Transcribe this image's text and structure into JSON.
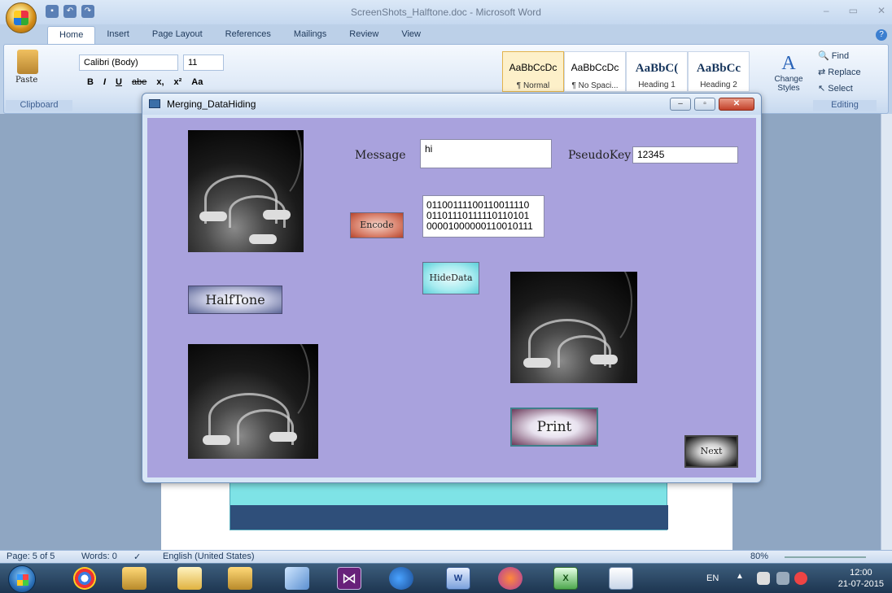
{
  "word": {
    "title": "ScreenShots_Halftone.doc - Microsoft Word",
    "tabs": [
      "Home",
      "Insert",
      "Page Layout",
      "References",
      "Mailings",
      "Review",
      "View"
    ],
    "font_name": "Calibri (Body)",
    "font_size": "11",
    "format_buttons": [
      "B",
      "I",
      "U",
      "abe",
      "x,",
      "x²",
      "Aa"
    ],
    "paste_label": "Paste",
    "group_labels": {
      "clipboard": "Clipboard",
      "editing": "Editing"
    },
    "styles": [
      {
        "preview": "AaBbCcDc",
        "name": "¶ Normal"
      },
      {
        "preview": "AaBbCcDc",
        "name": "¶ No Spaci..."
      },
      {
        "preview": "AaBbC(",
        "name": "Heading 1"
      },
      {
        "preview": "AaBbCc",
        "name": "Heading 2"
      }
    ],
    "change_styles": "Change Styles",
    "editing": {
      "find": "Find",
      "replace": "Replace",
      "select": "Select"
    },
    "status": {
      "page": "Page: 5 of 5",
      "words": "Words: 0",
      "language": "English (United States)",
      "zoom": "80%"
    }
  },
  "app": {
    "title": "Merging_DataHiding",
    "message_label": "Message",
    "message_value": "hi",
    "pseudokey_label": "PseudoKey",
    "pseudokey_value": "12345",
    "binary_lines": [
      "01100111100110011110",
      "01101110111110110101",
      "00001000000110010111"
    ],
    "buttons": {
      "encode": "Encode",
      "halftone": "HalfTone",
      "hidedata": "HideData",
      "print": "Print",
      "next": "Next"
    }
  },
  "taskbar": {
    "language": "EN",
    "time": "12:00",
    "date": "21-07-2015"
  }
}
